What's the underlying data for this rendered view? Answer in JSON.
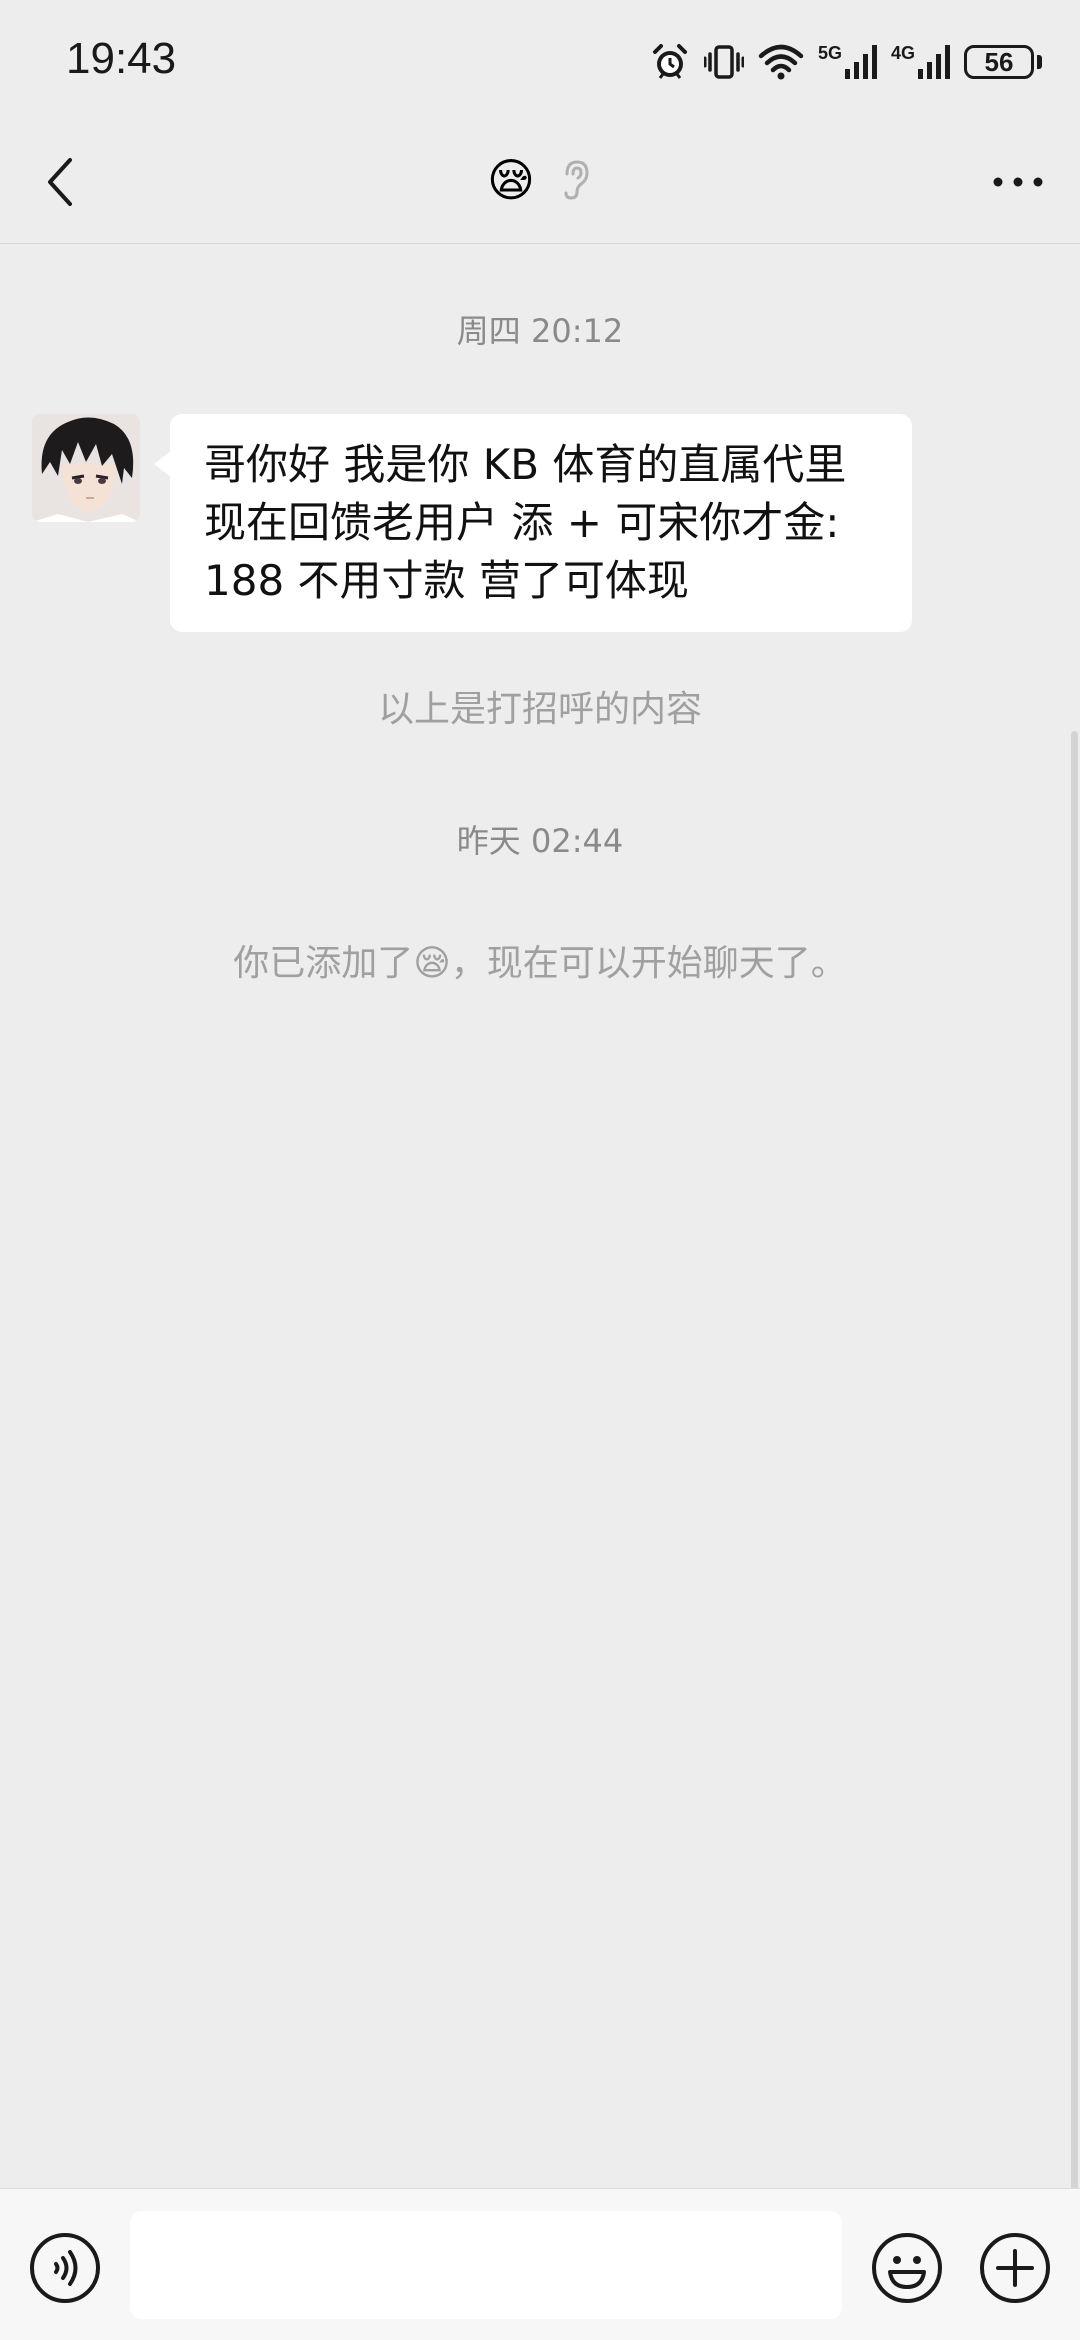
{
  "status_bar": {
    "time": "19:43",
    "network_5g": "5G",
    "network_4g": "4G",
    "battery": "56"
  },
  "nav": {
    "title_emoji": "😪",
    "back_icon": "chevron-left-icon",
    "more_icon": "more-horizontal-icon",
    "ear_icon": "ear-icon"
  },
  "chat": {
    "timestamp_1": "周四 20:12",
    "message_lines": [
      "哥你好 我是你 KB 体育的直属代里",
      "现在回馈老用户 添 + 可宋你才金:",
      "188 不用寸款  营了可体现"
    ],
    "greeting_note": "以上是打招呼的内容",
    "timestamp_2": "昨天 02:44",
    "added_notice": "你已添加了😪，现在可以开始聊天了。"
  },
  "input_bar": {
    "placeholder": "",
    "voice_icon": "voice-icon",
    "emoji_icon": "smiley-icon",
    "plus_icon": "plus-circle-icon"
  }
}
